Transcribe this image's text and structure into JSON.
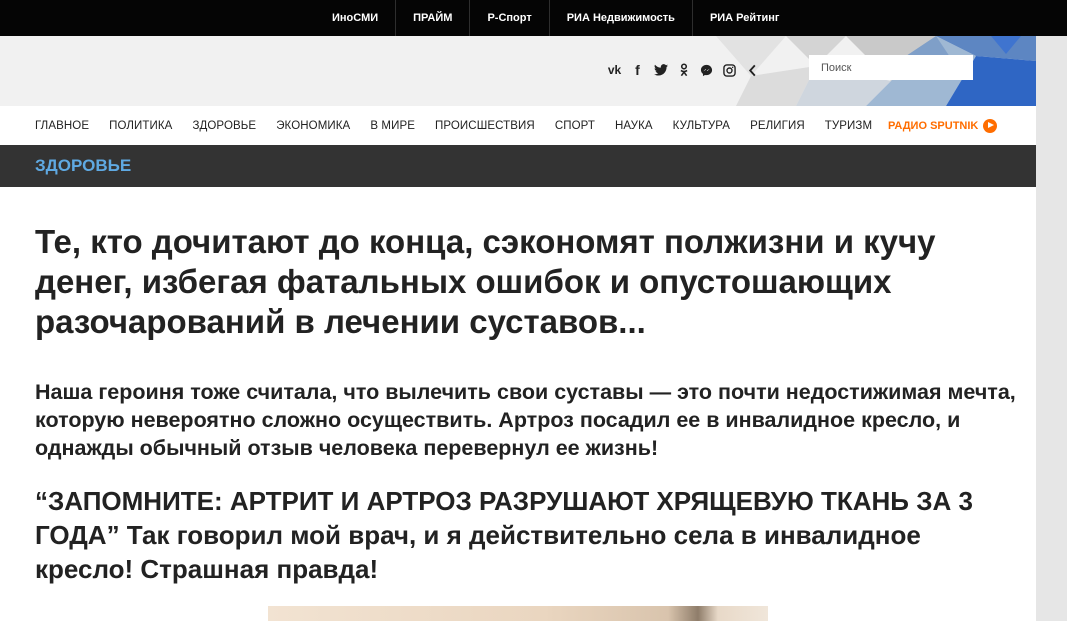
{
  "topbar": {
    "links": [
      "ИноСМИ",
      "ПРАЙМ",
      "Р-Спорт",
      "РИА Недвижимость",
      "РИА Рейтинг"
    ]
  },
  "header": {
    "social": [
      {
        "icon": "vk-icon",
        "glyph": "vk"
      },
      {
        "icon": "facebook-icon",
        "glyph": "f"
      },
      {
        "icon": "twitter-icon",
        "glyph": "🐦"
      },
      {
        "icon": "odnoklassniki-icon",
        "glyph": "ꝋ"
      },
      {
        "icon": "messenger-icon",
        "glyph": "●"
      },
      {
        "icon": "instagram-icon",
        "glyph": "◻"
      },
      {
        "icon": "collapse-arrow-icon",
        "glyph": "‹"
      }
    ],
    "search_placeholder": "Поиск"
  },
  "nav": {
    "items": [
      "ГЛАВНОЕ",
      "ПОЛИТИКА",
      "ЗДОРОВЬЕ",
      "ЭКОНОМИКА",
      "В МИРЕ",
      "ПРОИСШЕСТВИЯ",
      "СПОРТ",
      "НАУКА",
      "КУЛЬТУРА",
      "РЕЛИГИЯ",
      "ТУРИЗМ"
    ],
    "radio_label": "РАДИО SPUTNIK"
  },
  "section": {
    "title": "ЗДОРОВЬЕ"
  },
  "article": {
    "headline": "Те, кто дочитают до конца, сэкономят полжизни и кучу денег, избегая фатальных ошибок и опустошающих разочарований в лечении суставов...",
    "lead": "Наша героиня тоже считала, что вылечить свои суставы — это почти недостижимая мечта, которую невероятно сложно осуществить. Артроз посадил ее в инвалидное кресло, и однажды обычный отзыв человека перевернул ее жизнь!",
    "quote": "“ЗАПОМНИТЕ: АРТРИТ И АРТРОЗ РАЗРУШАЮТ ХРЯЩЕВУЮ ТКАНЬ ЗА 3 ГОДА” Так говорил мой врач, и я действительно села в инвалидное кресло! Страшная правда!"
  },
  "colors": {
    "accent_orange": "#ff6d00",
    "section_blue": "#5fa9e2",
    "section_bg": "#333333",
    "topbar_bg": "#050505"
  }
}
